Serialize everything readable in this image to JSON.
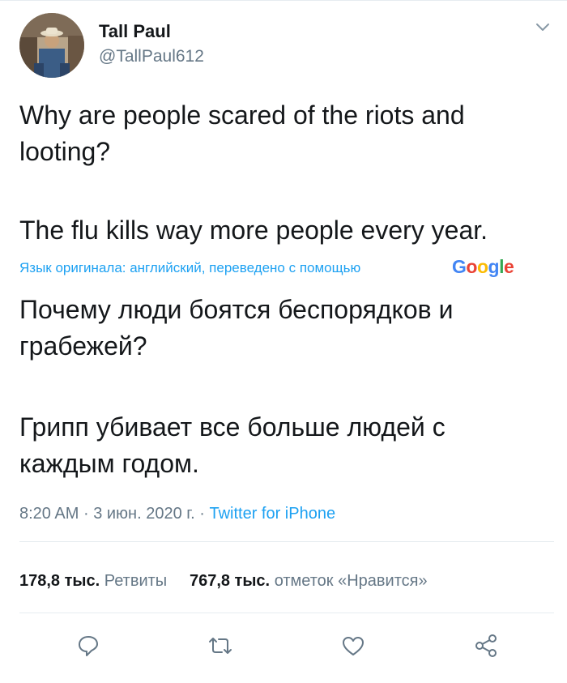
{
  "user": {
    "name": "Tall Paul",
    "handle": "@TallPaul612"
  },
  "tweet": {
    "text_en_1": "Why are people scared of the riots and looting?",
    "text_en_2": "The flu kills way more people every year.",
    "translation_note": "Язык оригинала: английский, переведено с помощью",
    "translation_provider": "Google",
    "text_ru_1": "Почему люди боятся беспорядков и грабежей?",
    "text_ru_2": "Грипп убивает все больше людей с каждым годом."
  },
  "meta": {
    "time": "8:20 AM",
    "date": "3 июн. 2020 г.",
    "separator": "·",
    "source": "Twitter for iPhone"
  },
  "stats": {
    "retweets_count": "178,8 тыс.",
    "retweets_label": "Ретвиты",
    "likes_count": "767,8 тыс.",
    "likes_label": "отметок «Нравится»"
  },
  "colors": {
    "accent": "#1da1f2",
    "secondary_text": "#657786",
    "divider": "#e6ecf0"
  },
  "icons": {
    "reply": "reply-icon",
    "retweet": "retweet-icon",
    "like": "heart-icon",
    "share": "share-icon",
    "caret": "chevron-down-icon"
  }
}
